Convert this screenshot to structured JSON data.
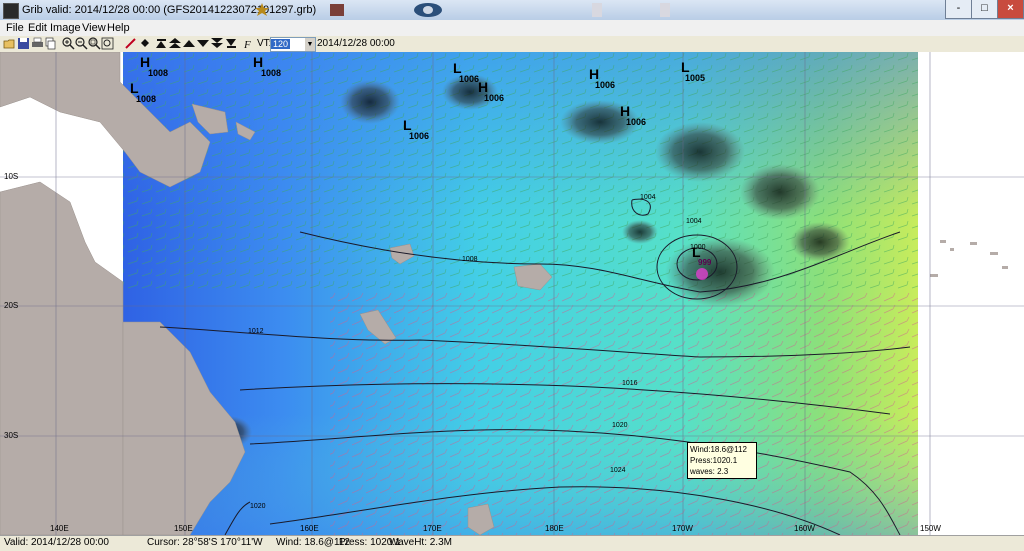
{
  "window": {
    "title": "Grib valid: 2014/12/28 00:00 (GFS20141223072101297.grb)",
    "controls": [
      "-",
      "□",
      "×"
    ]
  },
  "menu": [
    "File",
    "Edit",
    "Image",
    "View",
    "Help"
  ],
  "toolbar": {
    "vt_label": "VT:",
    "vt_value": "120",
    "date": "2014/12/28 00:00"
  },
  "map": {
    "lat_labels": [
      "10S",
      "20S",
      "30S"
    ],
    "lon_labels": [
      "140E",
      "150E",
      "160E",
      "170E",
      "180E",
      "170W",
      "160W",
      "150W"
    ],
    "pressure_centers": [
      {
        "type": "H",
        "value": "1008"
      },
      {
        "type": "L",
        "value": "1008"
      },
      {
        "type": "H",
        "value": "1008"
      },
      {
        "type": "L",
        "value": "1006"
      },
      {
        "type": "H",
        "value": "1006"
      },
      {
        "type": "L",
        "value": "1006"
      },
      {
        "type": "H",
        "value": "1006"
      },
      {
        "type": "L",
        "value": "1005"
      },
      {
        "type": "H",
        "value": "1006"
      },
      {
        "type": "L",
        "value": "999"
      }
    ],
    "isobar_labels": [
      "1008",
      "1012",
      "1016",
      "1020",
      "1024",
      "1020",
      "1004",
      "1004",
      "1000"
    ],
    "colors": {
      "land": "#b5aca8",
      "calm": "#2c5fe0",
      "moderate": "#3fd6e6",
      "strong": "#7cdc6c",
      "storm": "#121212"
    }
  },
  "tooltip": {
    "wind": "Wind:18.6@112",
    "press": "Press:1020.1",
    "waves": "waves: 2.3"
  },
  "status": {
    "valid": "Valid: 2014/12/28 00:00",
    "cursor": "Cursor: 28°58'S  170°11'W",
    "wind": "Wind: 18.6@112",
    "press": "Press: 1020.1",
    "wave": "WaveHt:  2.3M"
  }
}
